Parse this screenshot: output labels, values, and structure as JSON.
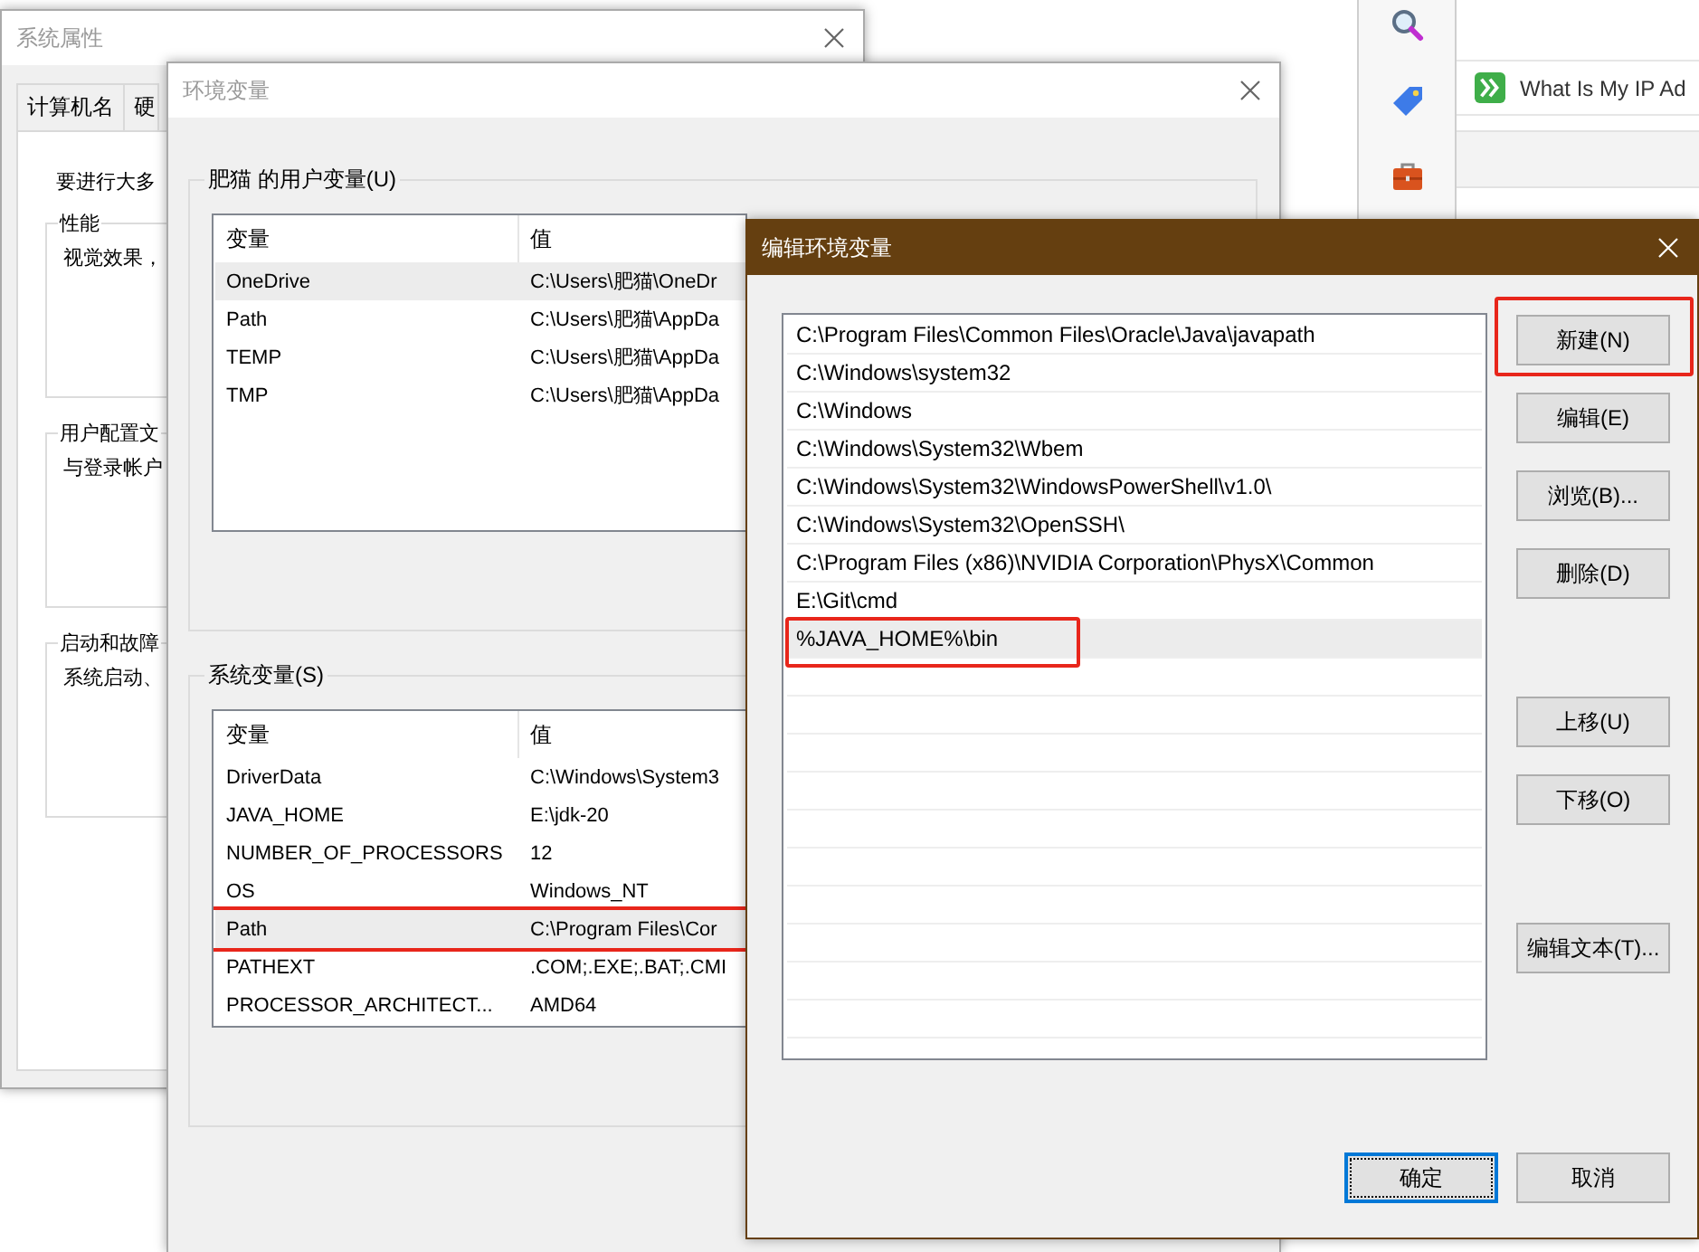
{
  "browser": {
    "bookmark": "What Is My IP Ad"
  },
  "system_properties": {
    "title": "系统属性",
    "tabs": [
      {
        "label": "计算机名",
        "selected": false
      },
      {
        "label": "硬",
        "selected": false
      }
    ],
    "intro": "要进行大多",
    "groups": [
      {
        "label": "性能",
        "text": "视觉效果，"
      },
      {
        "label": "用户配置文",
        "text": "与登录帐户"
      },
      {
        "label": "启动和故障",
        "text": "系统启动、"
      }
    ]
  },
  "environment_variables": {
    "title": "环境变量",
    "groups": [
      {
        "label": "肥猫 的用户变量(U)",
        "columns": [
          "变量",
          "值"
        ],
        "rows": [
          {
            "name": "OneDrive",
            "value": "C:\\Users\\肥猫\\OneDr",
            "selected": true,
            "annotated": false
          },
          {
            "name": "Path",
            "value": "C:\\Users\\肥猫\\AppDa",
            "selected": false,
            "annotated": false
          },
          {
            "name": "TEMP",
            "value": "C:\\Users\\肥猫\\AppDa",
            "selected": false,
            "annotated": false
          },
          {
            "name": "TMP",
            "value": "C:\\Users\\肥猫\\AppDa",
            "selected": false,
            "annotated": false
          }
        ]
      },
      {
        "label": "系统变量(S)",
        "columns": [
          "变量",
          "值"
        ],
        "rows": [
          {
            "name": "DriverData",
            "value": "C:\\Windows\\System3",
            "selected": false,
            "annotated": false
          },
          {
            "name": "JAVA_HOME",
            "value": "E:\\jdk-20",
            "selected": false,
            "annotated": false
          },
          {
            "name": "NUMBER_OF_PROCESSORS",
            "value": "12",
            "selected": false,
            "annotated": false
          },
          {
            "name": "OS",
            "value": "Windows_NT",
            "selected": false,
            "annotated": false
          },
          {
            "name": "Path",
            "value": "C:\\Program Files\\Cor",
            "selected": true,
            "annotated": true
          },
          {
            "name": "PATHEXT",
            "value": ".COM;.EXE;.BAT;.CMI",
            "selected": false,
            "annotated": false
          },
          {
            "name": "PROCESSOR_ARCHITECT...",
            "value": "AMD64",
            "selected": false,
            "annotated": false
          }
        ]
      }
    ]
  },
  "edit_dialog": {
    "title": "编辑环境变量",
    "entries": [
      {
        "text": "C:\\Program Files\\Common Files\\Oracle\\Java\\javapath",
        "selected": false,
        "annotated": false
      },
      {
        "text": "C:\\Windows\\system32",
        "selected": false,
        "annotated": false
      },
      {
        "text": "C:\\Windows",
        "selected": false,
        "annotated": false
      },
      {
        "text": "C:\\Windows\\System32\\Wbem",
        "selected": false,
        "annotated": false
      },
      {
        "text": "C:\\Windows\\System32\\WindowsPowerShell\\v1.0\\",
        "selected": false,
        "annotated": false
      },
      {
        "text": "C:\\Windows\\System32\\OpenSSH\\",
        "selected": false,
        "annotated": false
      },
      {
        "text": "C:\\Program Files (x86)\\NVIDIA Corporation\\PhysX\\Common",
        "selected": false,
        "annotated": false
      },
      {
        "text": "E:\\Git\\cmd",
        "selected": false,
        "annotated": false
      },
      {
        "text": "%JAVA_HOME%\\bin",
        "selected": true,
        "annotated": true
      }
    ],
    "side_buttons": [
      {
        "label": "新建(N)",
        "annotated": true
      },
      {
        "label": "编辑(E)",
        "annotated": false
      },
      {
        "label": "浏览(B)...",
        "annotated": false
      },
      {
        "label": "删除(D)",
        "annotated": false
      },
      {
        "label": "上移(U)",
        "annotated": false
      },
      {
        "label": "下移(O)",
        "annotated": false
      },
      {
        "label": "编辑文本(T)...",
        "annotated": false
      }
    ],
    "footer_buttons": [
      {
        "label": "确定",
        "focused": true
      },
      {
        "label": "取消",
        "focused": false
      }
    ]
  }
}
